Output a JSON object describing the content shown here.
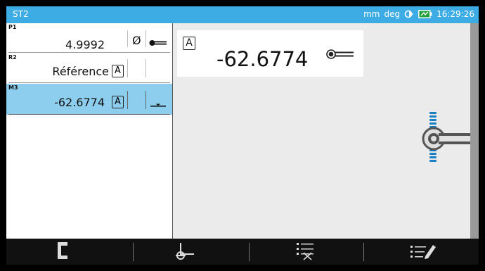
{
  "header": {
    "title": "ST2",
    "units_length": "mm",
    "units_angle": "deg"
  },
  "clock": "16:29:26",
  "list": {
    "rows": [
      {
        "label": "P1",
        "value": "4.9992",
        "symbol": "Ø",
        "probe": "probe-horizontal-icon"
      },
      {
        "label": "R2",
        "value": "Référence",
        "axis": "A"
      },
      {
        "label": "M3",
        "value": "-62.6774",
        "axis": "A",
        "selected": true
      }
    ]
  },
  "display": {
    "axis": "A",
    "value": "-62.6774"
  },
  "toolbar": {
    "icons": [
      "bracket-icon",
      "origin-icon",
      "list-delete-icon",
      "list-edit-icon"
    ]
  },
  "colors": {
    "header_bg": "#3dace4",
    "selected_row": "#8dcdee",
    "display_bg": "#ebebeb",
    "toolbar_bg": "#111111",
    "probe_blue": "#1d7fc4"
  }
}
